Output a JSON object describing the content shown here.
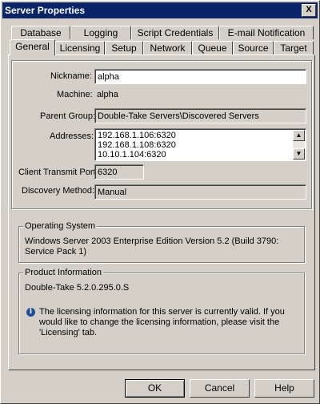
{
  "window": {
    "title": "Server Properties",
    "close_label": "X"
  },
  "tabs_back": [
    {
      "label": "Database"
    },
    {
      "label": "Logging"
    },
    {
      "label": "Script Credentials"
    },
    {
      "label": "E-mail Notification"
    }
  ],
  "tabs_front": [
    {
      "label": "General",
      "active": true
    },
    {
      "label": "Licensing"
    },
    {
      "label": "Setup"
    },
    {
      "label": "Network"
    },
    {
      "label": "Queue"
    },
    {
      "label": "Source"
    },
    {
      "label": "Target"
    }
  ],
  "general": {
    "nickname_label": "Nickname:",
    "nickname_value": "alpha",
    "machine_label": "Machine:",
    "machine_value": "alpha",
    "parent_group_label": "Parent Group:",
    "parent_group_value": "Double-Take Servers\\Discovered Servers",
    "addresses_label": "Addresses:",
    "addresses": [
      "192.168.1.106:6320",
      "192.168.1.108:6320",
      "10.10.1.104:6320"
    ],
    "client_port_label": "Client Transmit Port:",
    "client_port_value": "6320",
    "discovery_label": "Discovery Method:",
    "discovery_value": "Manual"
  },
  "os_group": {
    "title": "Operating System",
    "text": "Windows Server 2003 Enterprise Edition Version 5.2 (Build 3790: Service Pack 1)"
  },
  "product_group": {
    "title": "Product Information",
    "version": "Double-Take 5.2.0.295.0.S",
    "license_note": "The licensing information for this server is currently valid. If you would like to change the licensing information, please visit the 'Licensing' tab.",
    "info_icon": "i"
  },
  "buttons": {
    "ok": "OK",
    "cancel": "Cancel",
    "help": "Help"
  }
}
